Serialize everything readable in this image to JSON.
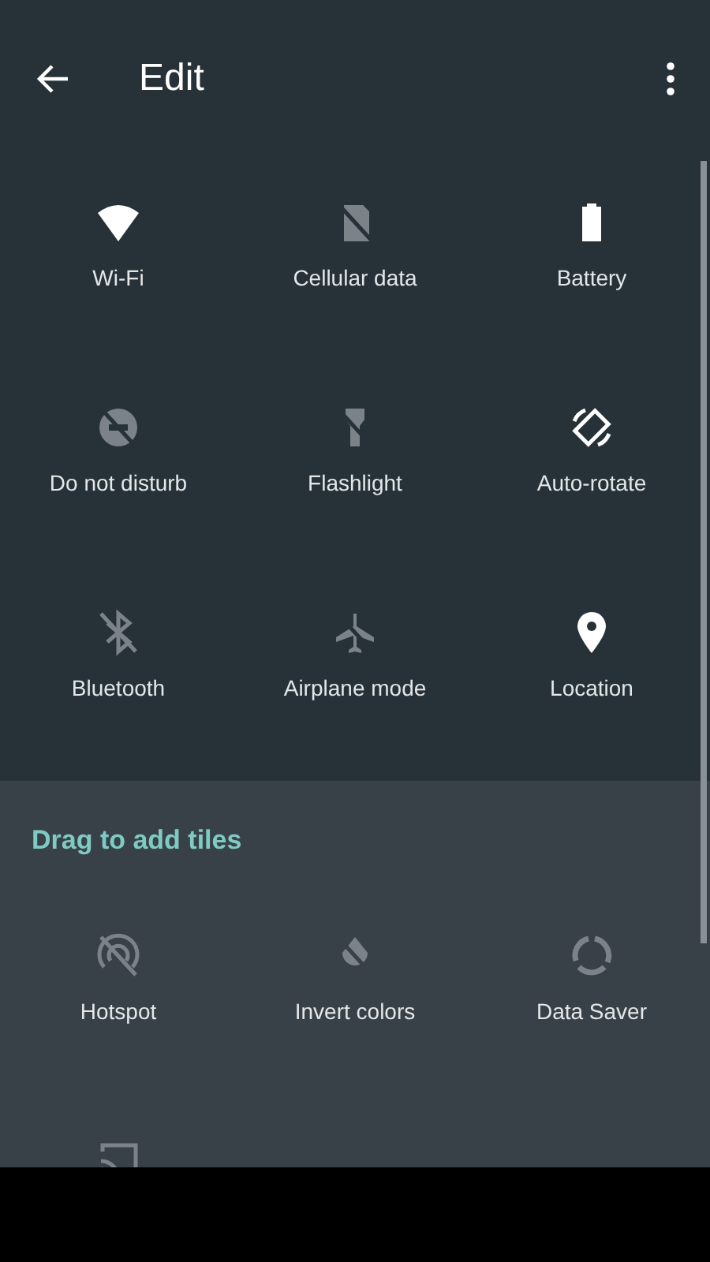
{
  "header": {
    "title": "Edit"
  },
  "active_tiles": [
    {
      "label": "Wi-Fi",
      "on": true
    },
    {
      "label": "Cellular data",
      "on": false
    },
    {
      "label": "Battery",
      "on": true
    },
    {
      "label": "Do not disturb",
      "on": false
    },
    {
      "label": "Flashlight",
      "on": false
    },
    {
      "label": "Auto-rotate",
      "on": true
    },
    {
      "label": "Bluetooth",
      "on": false
    },
    {
      "label": "Airplane mode",
      "on": false
    },
    {
      "label": "Location",
      "on": true
    }
  ],
  "available_section": {
    "title": "Drag to add tiles",
    "tiles": [
      {
        "label": "Hotspot",
        "on": false
      },
      {
        "label": "Invert colors",
        "on": false
      },
      {
        "label": "Data Saver",
        "on": false
      },
      {
        "on": false
      }
    ]
  }
}
